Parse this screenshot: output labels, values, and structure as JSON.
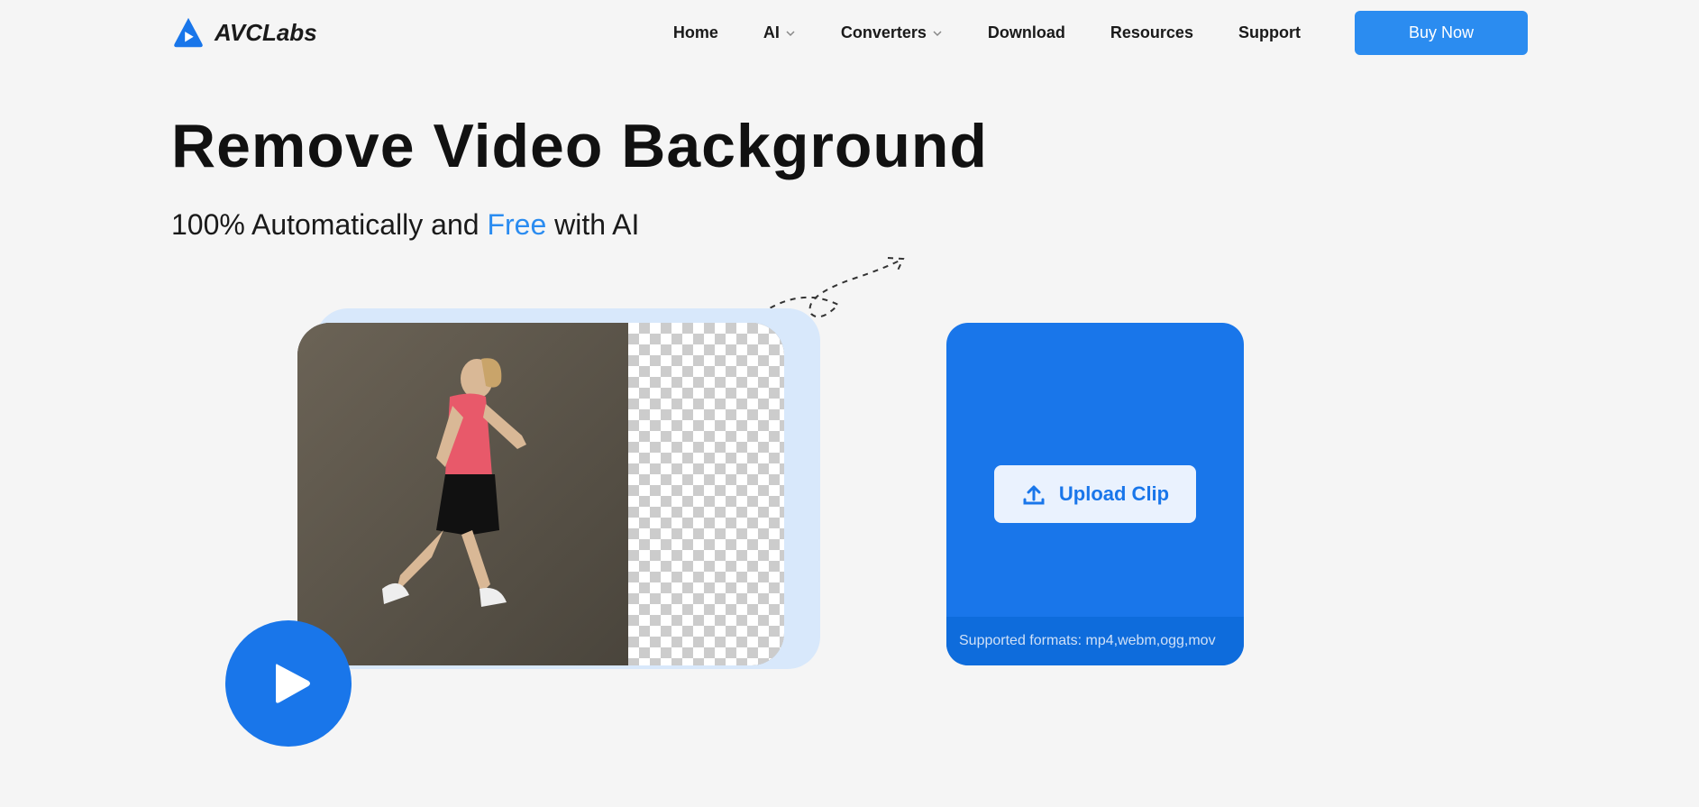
{
  "brand": "AVCLabs",
  "nav": {
    "home": "Home",
    "ai": "AI",
    "converters": "Converters",
    "download": "Download",
    "resources": "Resources",
    "support": "Support"
  },
  "cta": {
    "buy_now": "Buy Now"
  },
  "hero": {
    "title": "Remove Video Background",
    "subtitle_pre": "100% Automatically and ",
    "subtitle_free": "Free",
    "subtitle_post": " with AI"
  },
  "upload": {
    "button": "Upload Clip",
    "formats": "Supported formats: mp4,webm,ogg,mov"
  }
}
